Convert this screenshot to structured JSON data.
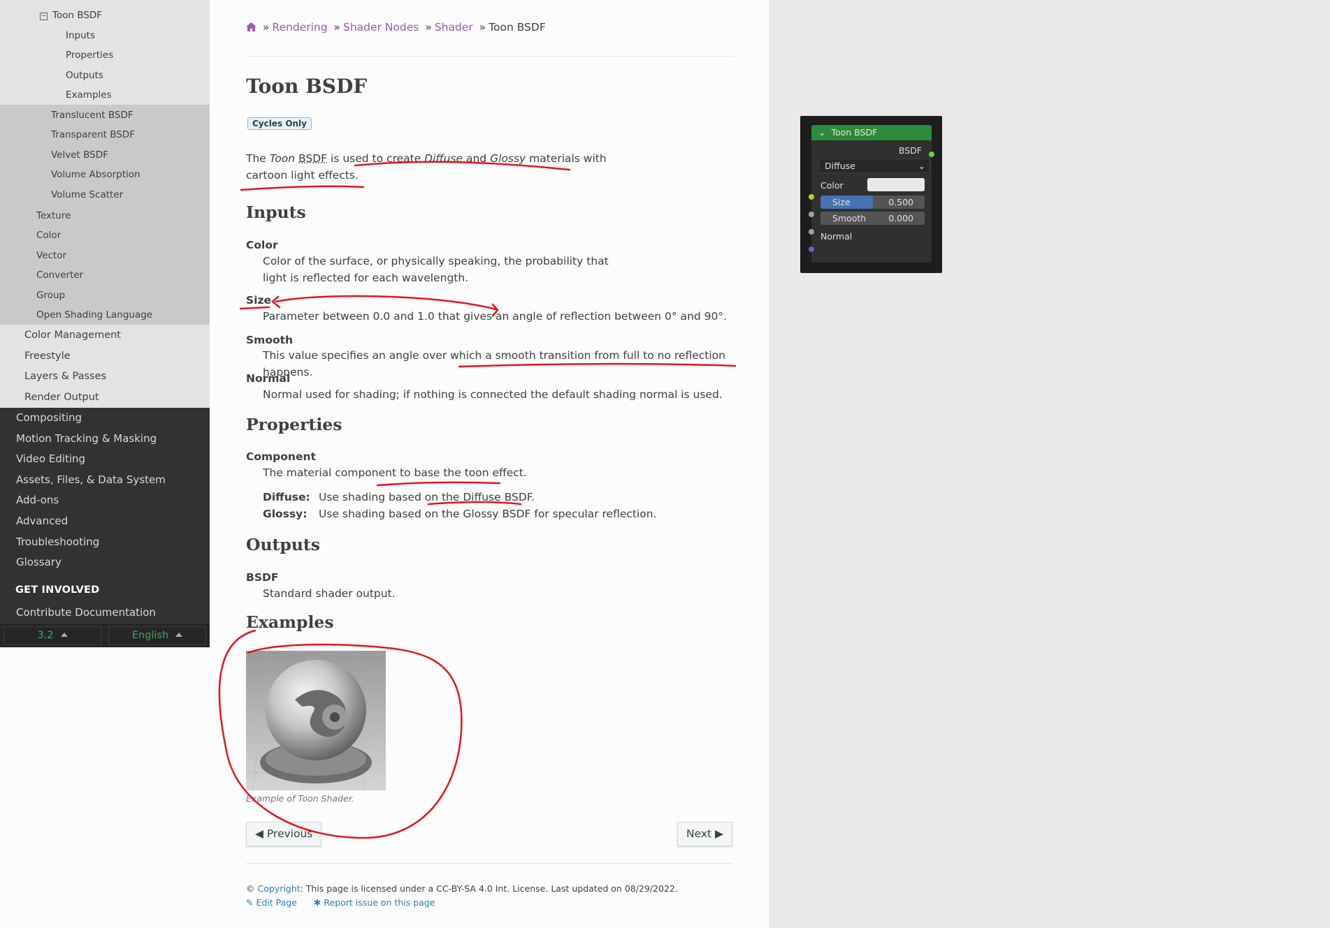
{
  "sidebar": {
    "level4_current": "Toon BSDF",
    "level4_sub": [
      "Inputs",
      "Properties",
      "Outputs",
      "Examples"
    ],
    "level3_after": [
      "Translucent BSDF",
      "Transparent BSDF",
      "Velvet BSDF",
      "Volume Absorption",
      "Volume Scatter"
    ],
    "level2": [
      "Texture",
      "Color",
      "Vector",
      "Converter",
      "Group",
      "Open Shading Language"
    ],
    "level1": [
      "Color Management",
      "Freestyle",
      "Layers & Passes",
      "Render Output"
    ],
    "top": [
      "Compositing",
      "Motion Tracking & Masking",
      "Video Editing",
      "Assets, Files, & Data System",
      "Add-ons",
      "Advanced",
      "Troubleshooting",
      "Glossary"
    ],
    "caption": "GET INVOLVED",
    "contribute": "Contribute Documentation",
    "version": "3.2",
    "language": "English"
  },
  "breadcrumbs": {
    "home_icon": "home-icon",
    "items": [
      "Rendering",
      "Shader Nodes",
      "Shader"
    ],
    "current": "Toon BSDF",
    "sep": "»"
  },
  "page": {
    "title": "Toon BSDF",
    "badge": "Cycles Only",
    "intro": {
      "p1": "The ",
      "toon": "Toon",
      "bsdf": "BSDF",
      "p2": " is used to create ",
      "diffuse": "Diffuse",
      "and": " and ",
      "glossy": "Glossy",
      "p3": " materials with",
      "line2": "cartoon light effects."
    },
    "inputs_heading": "Inputs",
    "inputs": [
      {
        "term": "Color",
        "def1": "Color of the surface, or physically speaking, the probability that",
        "def2": "light is reflected for each wavelength."
      },
      {
        "term": "Size",
        "def1": "Parameter between 0.0 and 1.0 that gives an angle of reflection between 0° and 90°."
      },
      {
        "term": "Smooth",
        "def1": "This value specifies an angle over which a smooth transition from full to no reflection happens."
      },
      {
        "term": "Normal",
        "def1": "Normal used for shading; if nothing is connected the default shading normal is used."
      }
    ],
    "properties_heading": "Properties",
    "component_term": "Component",
    "component_def": "The material component to base the toon effect.",
    "options": [
      {
        "name": "Diffuse:",
        "desc_pre": "Use shading based on the ",
        "desc_link": "Diffuse BSDF.",
        "desc_post": ""
      },
      {
        "name": "Glossy:",
        "desc_pre": "Use shading based on the Glossy BSDF for specular reflection.",
        "desc_link": "",
        "desc_post": ""
      }
    ],
    "outputs_heading": "Outputs",
    "output_term": "BSDF",
    "output_def": "Standard shader output.",
    "examples_heading": "Examples",
    "example_caption": "Example of Toon Shader.",
    "prev": "Previous",
    "next": "Next"
  },
  "node": {
    "title": "Toon BSDF",
    "output": "BSDF",
    "dropdown": "Diffuse",
    "color_label": "Color",
    "size_label": "Size",
    "size_value": "0.500",
    "size_fill": 0.5,
    "smooth_label": "Smooth",
    "smooth_value": "0.000",
    "normal_label": "Normal",
    "colors": {
      "header": "#2d8a3a",
      "shader_socket": "#5fd33f",
      "color_socket": "#c7c729",
      "value_socket": "#a1a1a1",
      "vector_socket": "#6363c7",
      "slider_fill": "#4772b3"
    }
  },
  "footer": {
    "copyright_sym": "©",
    "copyright_link": "Copyright",
    "license": ": This page is licensed under a CC-BY-SA 4.0 Int. License. Last updated on 08/29/2022.",
    "edit": "Edit Page",
    "report": "Report issue on this page"
  },
  "colors": {
    "sidebar_bg": "#343131",
    "link": "#9b59b6",
    "footer_link": "#2980b9",
    "version_green": "#27ae60",
    "annotation_red": "#e8141b"
  }
}
